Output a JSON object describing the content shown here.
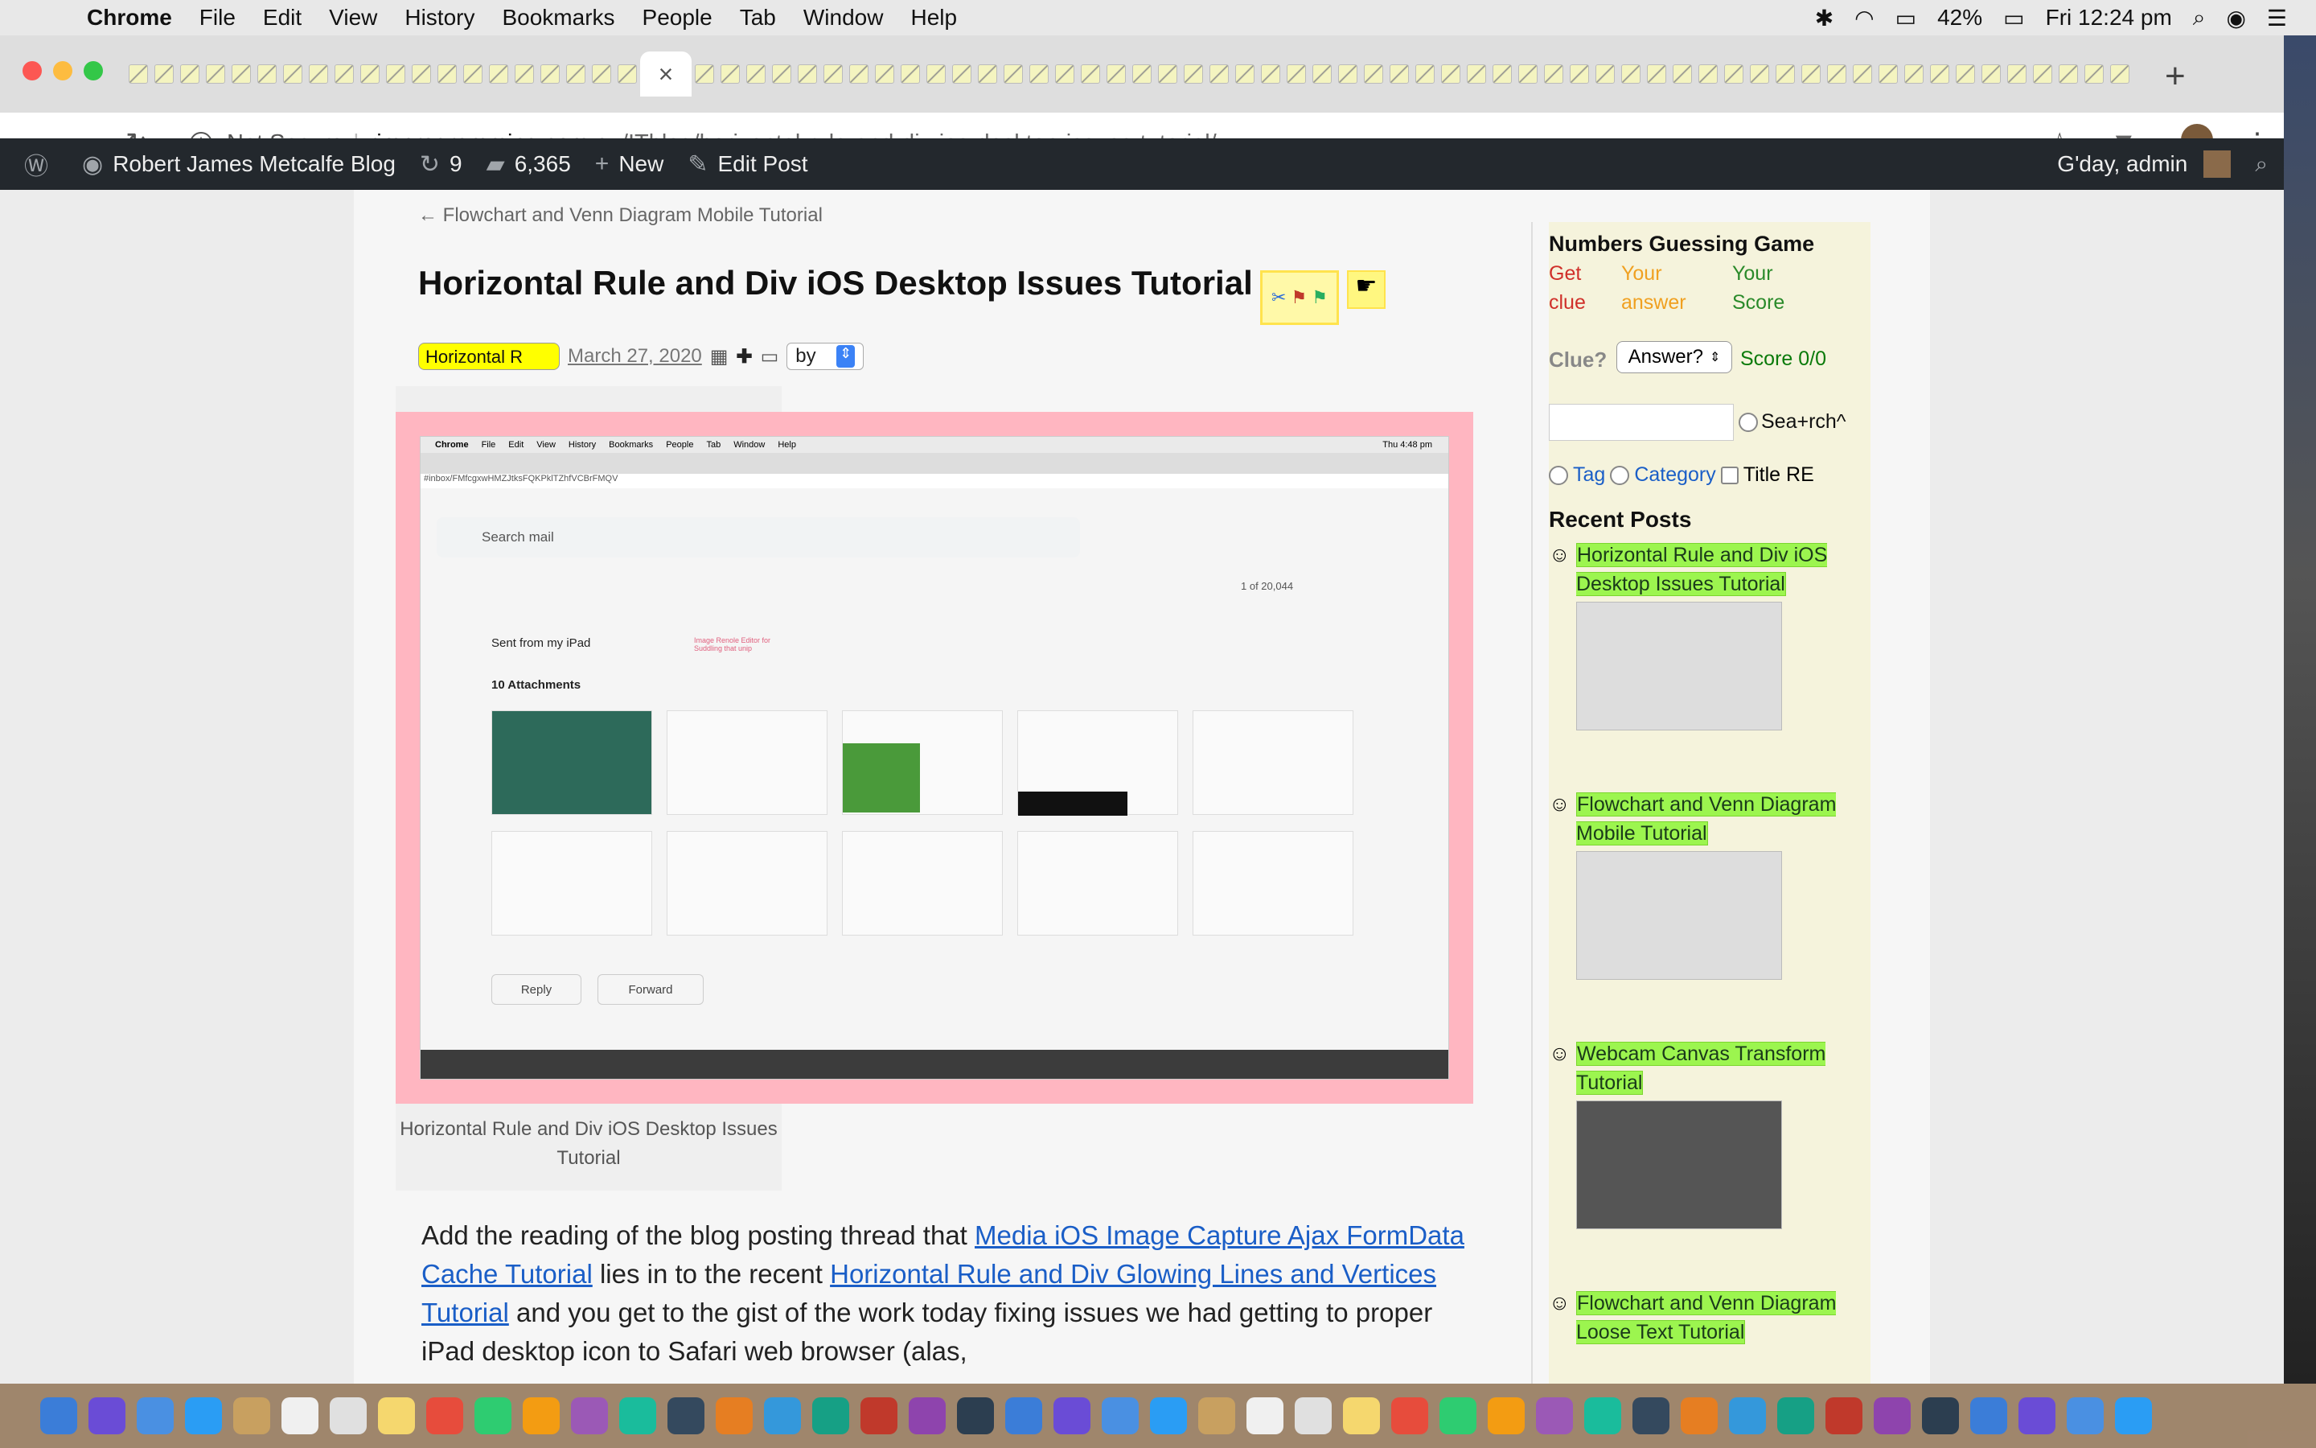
{
  "menubar": {
    "app": "Chrome",
    "items": [
      "File",
      "Edit",
      "View",
      "History",
      "Bookmarks",
      "People",
      "Tab",
      "Window",
      "Help"
    ],
    "battery": "42%",
    "clock": "Fri 12:24 pm"
  },
  "browser": {
    "address_insecure": "Not Secure",
    "address_host": "rjmprogramming.com.au",
    "address_path": "/ITblog/horizontal-rule-and-div-ios-desktop-issues-tutorial/"
  },
  "adminbar": {
    "site_name": "Robert James Metcalfe Blog",
    "updates": "9",
    "comments": "6,365",
    "new_label": "New",
    "edit_label": "Edit Post",
    "greeting": "G'day, admin"
  },
  "post": {
    "prev_link": "← Flowchart and Venn Diagram Mobile Tutorial",
    "title": "Horizontal Rule and Div iOS Desktop Issues Tutorial",
    "select_label": "Horizontal R",
    "date": "March 27, 2020",
    "by_label": "by",
    "caption": "Horizontal Rule and Div iOS Desktop Issues Tutorial",
    "body": {
      "t1": "Add the reading of the blog posting thread that ",
      "link1": "Media iOS Image Capture Ajax FormData Cache Tutorial",
      "t2": " lies in to the recent ",
      "link2": "Horizontal Rule and Div Glowing Lines and Vertices Tutorial",
      "t3": " and you get to the gist of the work today fixing issues we had getting to proper iPad desktop icon to Safari web browser (alas,"
    }
  },
  "screenshot": {
    "menubar_items": [
      "Chrome",
      "File",
      "Edit",
      "View",
      "History",
      "Bookmarks",
      "People",
      "Tab",
      "Window",
      "Help"
    ],
    "clock": "Thu 4:48 pm",
    "url": "#inbox/FMfcgxwHMZJtksFQKPklTZhfVCBrFMQV",
    "search_placeholder": "Search mail",
    "counter": "1 of 20,044",
    "sent": "Sent from my iPad",
    "attachments": "10 Attachments",
    "annotation": "Image Renole Editor for Suddling that unip",
    "reply": "Reply",
    "forward": "Forward"
  },
  "sidebar": {
    "game_title": "Numbers Guessing Game",
    "col1": [
      "Get",
      "clue"
    ],
    "col2": [
      "Your",
      "answer"
    ],
    "col3": [
      "Your",
      "Score"
    ],
    "clue_label": "Clue?",
    "answer_select": "Answer?",
    "score": "Score 0/0",
    "search_label": "Sea+rch^",
    "tag_label": "Tag",
    "category_label": "Category",
    "title_re_label": "Title RE",
    "recent_title": "Recent Posts",
    "recent_posts": [
      "Horizontal Rule and Div iOS Desktop Issues Tutorial",
      "Flowchart and Venn Diagram Mobile Tutorial",
      "Webcam Canvas Transform Tutorial",
      "Flowchart and Venn Diagram Loose Text Tutorial"
    ]
  },
  "colors": {
    "pink_frame": "#ffb6c1",
    "link": "#1a5ec7",
    "highlight": "#9cf54f",
    "adminbar": "#23282d"
  }
}
